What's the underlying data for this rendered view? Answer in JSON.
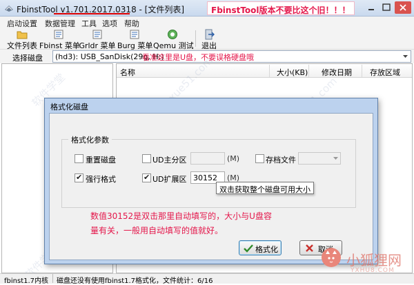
{
  "window": {
    "title": "FbinstTool v1.701.2017.0318 - [文件列表]",
    "annotation": "FbinstTool版本不要比这个旧！！！"
  },
  "menu": [
    "启动设置",
    "数据管理",
    "工具",
    "选项",
    "帮助"
  ],
  "toolbar": [
    {
      "label": "文件列表",
      "icon": "folder-icon"
    },
    {
      "label": "Fbinst 菜单",
      "icon": "menu-icon"
    },
    {
      "label": "Grldr 菜单",
      "icon": "menu-icon"
    },
    {
      "label": "Burg 菜单",
      "icon": "menu-icon"
    },
    {
      "label": "Qemu 测试",
      "icon": "qemu-icon"
    },
    {
      "label": "退出",
      "icon": "exit-icon"
    }
  ],
  "disk": {
    "label": "选择磁盘",
    "value": "(hd3): USB_SanDisk(29g, H:)",
    "annotation": "看准这里是U盘，不要误格硬盘哦"
  },
  "list": {
    "columns": [
      "名称",
      "大小(KB)",
      "修改日期",
      "存放区域"
    ]
  },
  "status": {
    "left": "fbinst1.7内核",
    "right": "磁盘还没有使用fbinst1.7格式化，文件统计：6/16"
  },
  "dialog": {
    "title": "格式化磁盘",
    "group_title": "格式化参数",
    "options": {
      "reformat": {
        "label": "重置磁盘",
        "checked": false
      },
      "ud_primary": {
        "label": "UD主分区",
        "checked": false,
        "unit": "(M)"
      },
      "archive": {
        "label": "存档文件",
        "checked": false
      },
      "force": {
        "label": "强行格式",
        "checked": true
      },
      "ud_extended": {
        "label": "UD扩展区",
        "checked": true,
        "value": "30152",
        "unit": "(M)"
      }
    },
    "tooltip": "双击获取整个磁盘可用大小",
    "note_line1": "数值30152是双击那里自动填写的，大小与U盘容",
    "note_line2": "量有关，一般用自动填写的值就好。",
    "ok_label": "格式化",
    "cancel_label": "取消"
  },
  "branding": {
    "name": "小狐狸网",
    "sub": "YXHU8.COM"
  },
  "colors": {
    "annotation": "#e4164a",
    "dialog_frame": "#bcd2ee",
    "titlebar": "#c9d9ee"
  }
}
